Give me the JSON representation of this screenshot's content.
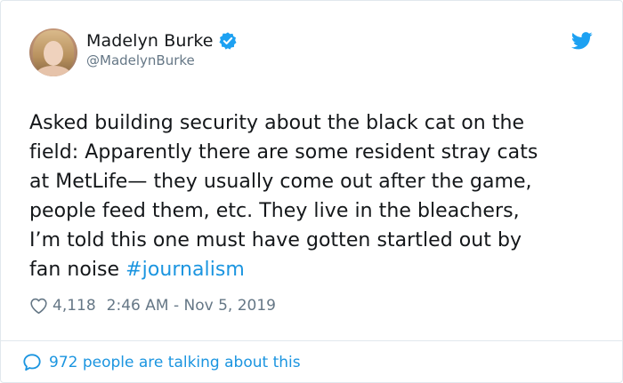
{
  "user": {
    "display_name": "Madelyn Burke",
    "handle": "@MadelynBurke"
  },
  "icons": {
    "verified": "verified-badge-icon",
    "platform": "twitter-bird-icon",
    "like": "heart-icon",
    "reply": "speech-bubble-icon",
    "avatar": "profile-photo"
  },
  "tweet": {
    "text_lines": [
      "Asked building security about the black cat on the",
      "field: Apparently there are some resident stray cats",
      "at MetLife— they usually come out after the game,",
      "people feed them, etc. They live in the bleachers,",
      "I’m told this one must have gotten startled out by",
      "fan noise "
    ],
    "hashtag": "#journalism"
  },
  "meta": {
    "like_count": "4,118",
    "timestamp": "2:46 AM - Nov 5, 2019"
  },
  "footer": {
    "talking_text": "972 people are talking about this"
  },
  "colors": {
    "accent": "#1b95e0",
    "text": "#14171a",
    "muted": "#657786",
    "border": "#e1e8ed"
  }
}
